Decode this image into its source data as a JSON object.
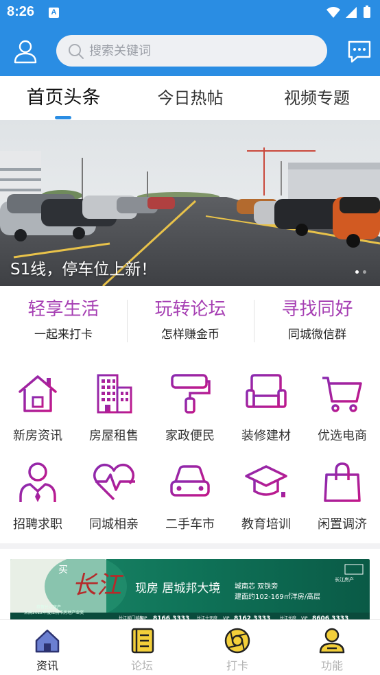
{
  "status_bar": {
    "time": "8:26",
    "badge": "A"
  },
  "search": {
    "placeholder": "搜索关键词"
  },
  "tabs": [
    {
      "label": "首页头条",
      "active": true
    },
    {
      "label": "今日热帖",
      "active": false
    },
    {
      "label": "视频专题",
      "active": false
    }
  ],
  "banner": {
    "caption": "S1线，停车位上新！",
    "slide_count": 2,
    "current_slide": 1
  },
  "features": [
    {
      "title": "轻享生活",
      "subtitle": "一起来打卡"
    },
    {
      "title": "玩转论坛",
      "subtitle": "怎样赚金币"
    },
    {
      "title": "寻找同好",
      "subtitle": "同城微信群"
    }
  ],
  "grid": [
    {
      "label": "新房资讯",
      "icon": "house-icon"
    },
    {
      "label": "房屋租售",
      "icon": "building-icon"
    },
    {
      "label": "家政便民",
      "icon": "paint-roller-icon"
    },
    {
      "label": "装修建材",
      "icon": "sofa-icon"
    },
    {
      "label": "优选电商",
      "icon": "cart-icon"
    },
    {
      "label": "招聘求职",
      "icon": "person-tie-icon"
    },
    {
      "label": "同城相亲",
      "icon": "heartbeat-icon"
    },
    {
      "label": "二手车市",
      "icon": "car-icon"
    },
    {
      "label": "教育培训",
      "icon": "graduation-cap-icon"
    },
    {
      "label": "闲置调济",
      "icon": "shopping-bag-icon"
    }
  ],
  "ad": {
    "brand_char": "买",
    "calligraphy": "长江",
    "slogan": "现房 居城邦大境",
    "tagline": "城南芯 双铁旁",
    "area": "建面约102-169㎡洋房/高层",
    "logo": "长江房产",
    "congrats_line1": "恭贺长江房产",
    "congrats_line2": "荣膺2022年度江阴市房地产业奖",
    "phone_blocks": [
      {
        "name": "长江城门城都",
        "vip": "VIP",
        "phone": "8166 3333"
      },
      {
        "name": "长江十天府",
        "vip": "VIP",
        "phone": "8162 3333"
      },
      {
        "name": "长江长府",
        "vip": "VIP",
        "phone": "8606 3333"
      }
    ]
  },
  "bottom_nav": [
    {
      "label": "资讯",
      "icon": "home-icon",
      "active": true
    },
    {
      "label": "论坛",
      "icon": "forum-icon",
      "active": false
    },
    {
      "label": "打卡",
      "icon": "camera-shutter-icon",
      "active": false
    },
    {
      "label": "功能",
      "icon": "user-service-icon",
      "active": false
    }
  ],
  "colors": {
    "header": "#2a8de3",
    "accent_purple": "#a63fb3",
    "icon_gradient_start": "#8a2bb0",
    "icon_gradient_end": "#c2188a",
    "nav_active": "#3f4fa8",
    "nav_inactive_fill": "#f3cf3a"
  }
}
